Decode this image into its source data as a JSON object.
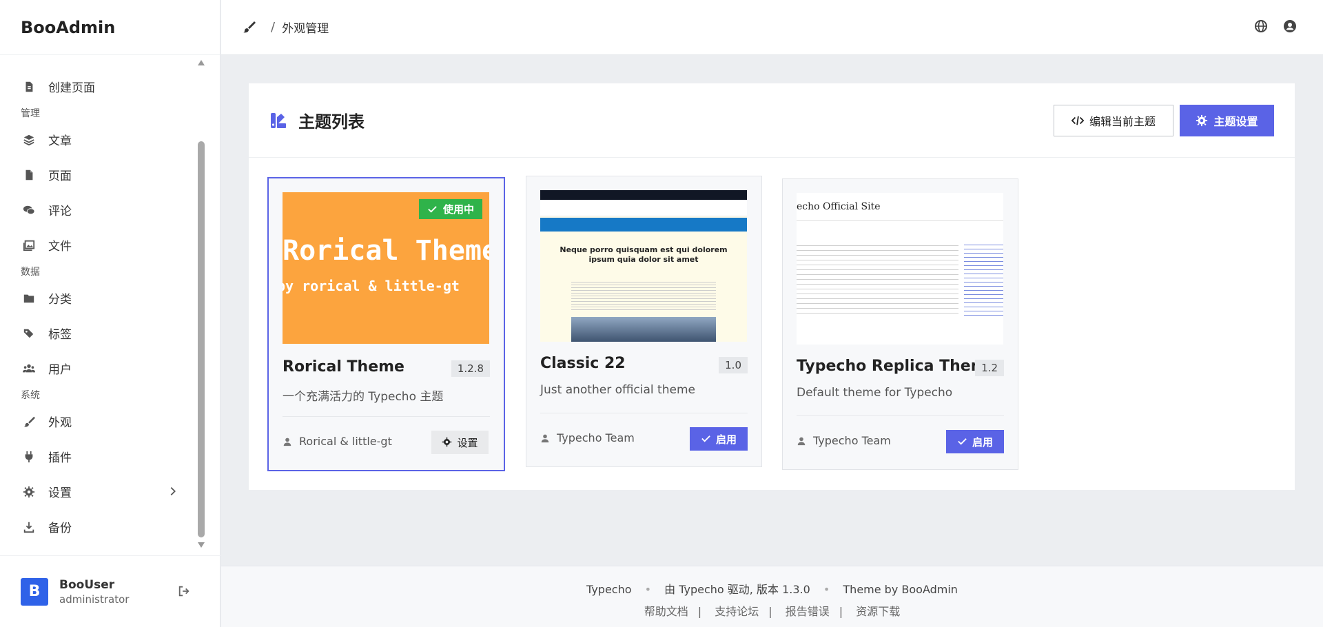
{
  "brand": "BooAdmin",
  "sidebar": {
    "items": [
      {
        "label": "创建页面",
        "icon": "file-add-icon"
      },
      {
        "group": "管理"
      },
      {
        "label": "文章",
        "icon": "layers-icon"
      },
      {
        "label": "页面",
        "icon": "file-icon"
      },
      {
        "label": "评论",
        "icon": "comments-icon"
      },
      {
        "label": "文件",
        "icon": "images-icon"
      },
      {
        "group": "数据"
      },
      {
        "label": "分类",
        "icon": "folder-icon"
      },
      {
        "label": "标签",
        "icon": "tags-icon"
      },
      {
        "label": "用户",
        "icon": "users-icon"
      },
      {
        "group": "系统"
      },
      {
        "label": "外观",
        "icon": "brush-icon"
      },
      {
        "label": "插件",
        "icon": "plug-icon"
      },
      {
        "label": "设置",
        "icon": "gear-icon"
      },
      {
        "label": "备份",
        "icon": "download-icon"
      }
    ]
  },
  "user": {
    "initial": "B",
    "name": "BooUser",
    "role": "administrator"
  },
  "header": {
    "breadcrumb_sep": "/",
    "breadcrumb": "外观管理"
  },
  "card": {
    "title": "主题列表",
    "edit_label": "编辑当前主题",
    "settings_label": "主题设置"
  },
  "themes": [
    {
      "name": "Rorical Theme",
      "version": "1.2.8",
      "desc": "一个充满活力的 Typecho 主题",
      "author": "Rorical & little-gt",
      "action": "设置",
      "badge": "使用中",
      "thumb_title": "Rorical Theme",
      "thumb_sub": "by rorical & little-gt"
    },
    {
      "name": "Classic 22",
      "version": "1.0",
      "desc": "Just another official theme",
      "author": "Typecho Team",
      "action": "启用",
      "thumb_heading": "Neque porro quisquam est qui dolorem ipsum quia dolor sit amet"
    },
    {
      "name": "Typecho Replica Theme",
      "version": "1.2",
      "desc": "Default theme for Typecho",
      "author": "Typecho Team",
      "action": "启用",
      "thumb_heading": "echo Official Site"
    }
  ],
  "footer": {
    "brand": "Typecho",
    "powered": "由 Typecho 驱动, 版本 1.3.0",
    "theme_by": "Theme by BooAdmin",
    "links": [
      "帮助文档",
      "支持论坛",
      "报告错误",
      "资源下载"
    ]
  },
  "colors": {
    "accent": "#5a63e6",
    "active_badge": "#2fb34a",
    "avatar": "#2f62e8",
    "thumb_orange": "#fca43e"
  }
}
